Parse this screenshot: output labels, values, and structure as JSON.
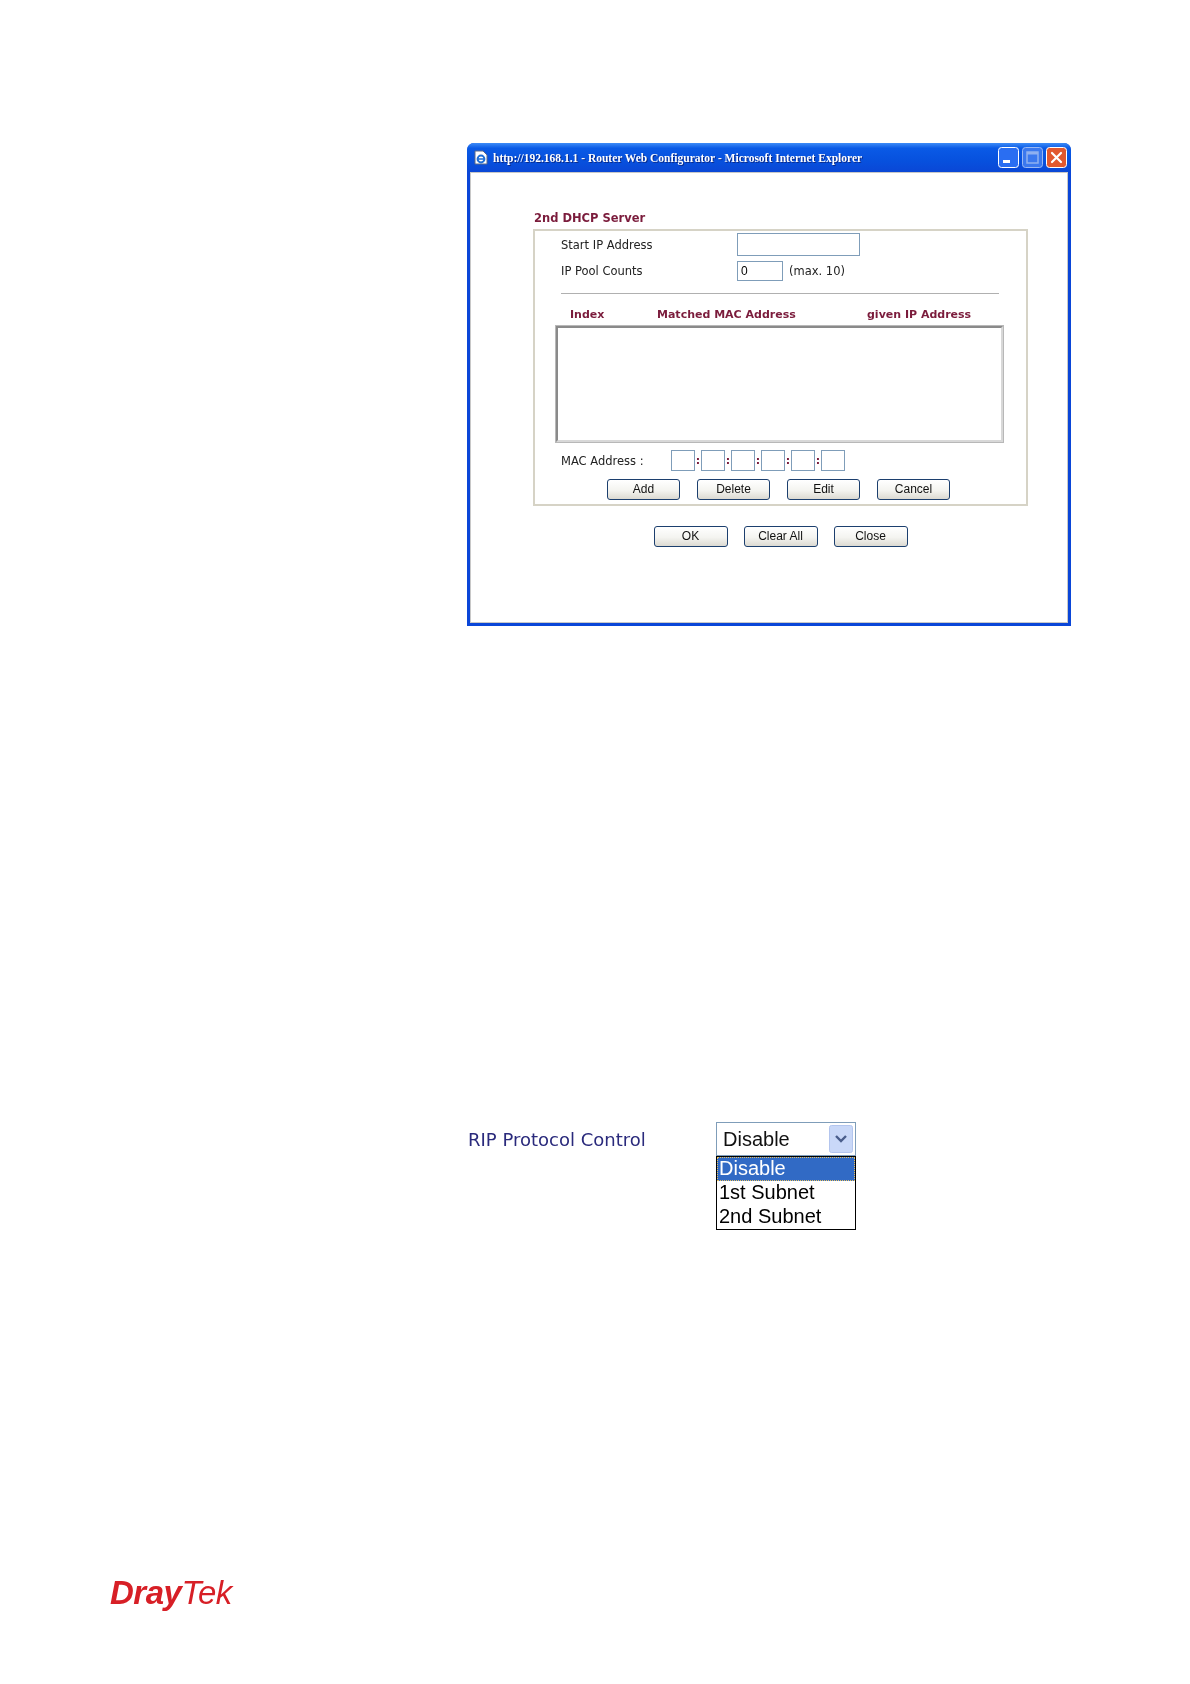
{
  "window": {
    "title": "http://192.168.1.1 - Router Web Configurator - Microsoft Internet Explorer",
    "controls": [
      {
        "kind": "minimize",
        "disabled": false
      },
      {
        "kind": "maximize",
        "disabled": true
      },
      {
        "kind": "close",
        "disabled": false
      }
    ]
  },
  "dhcp_server": {
    "heading": "2nd DHCP Server",
    "fields": [
      {
        "kind": "address",
        "label": "Start IP Address"
      },
      {
        "kind": "count",
        "label": "IP Pool Counts",
        "value": "0",
        "note": "(max. 10)"
      }
    ],
    "table": {
      "columns": [
        "Index",
        "Matched MAC Address",
        "given IP Address"
      ]
    },
    "mac_address": {
      "label": "MAC Address :",
      "separators": [
        ":",
        ":",
        ":",
        ":",
        ":"
      ]
    },
    "buttons": [
      "Add",
      "Delete",
      "Edit",
      "Cancel"
    ]
  },
  "dialog_buttons": [
    "OK",
    "Clear All",
    "Close"
  ],
  "rip": {
    "label": "RIP Protocol Control",
    "value": "Disable",
    "expanded": true,
    "options": [
      {
        "label": "Disable",
        "selected": true
      },
      {
        "label": "1st Subnet",
        "selected": false
      },
      {
        "label": "2nd Subnet",
        "selected": false
      }
    ]
  },
  "logo": "**Dray**Tek"
}
